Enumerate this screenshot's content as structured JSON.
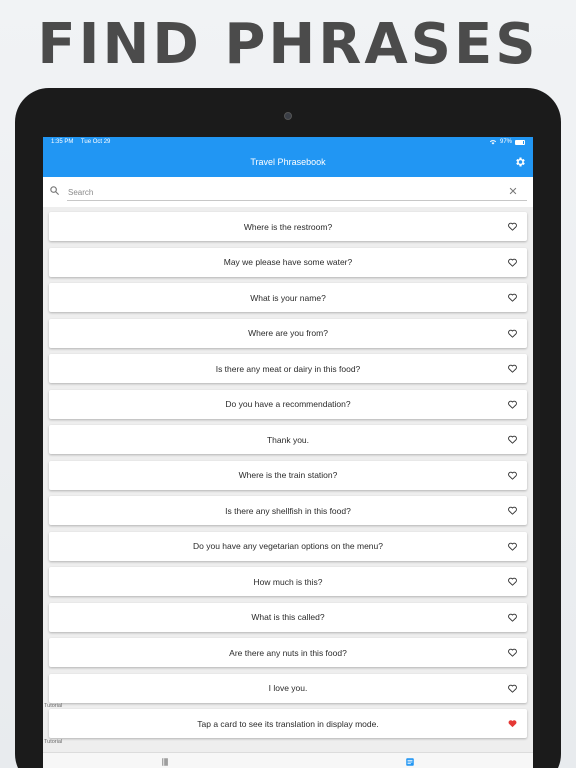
{
  "headline": "FIND PHRASES",
  "status": {
    "time": "1:35 PM",
    "date": "Tue Oct 29",
    "battery": "97%"
  },
  "app": {
    "title": "Travel Phrasebook"
  },
  "search": {
    "placeholder": "Search",
    "value": ""
  },
  "phrases": [
    "Where is the restroom?",
    "May we please have some water?",
    "What is your name?",
    "Where are you from?",
    "Is there any meat or dairy in this food?",
    "Do you have a recommendation?",
    "Thank you.",
    "Where is the train station?",
    "Is there any shellfish in this food?",
    "Do you have any vegetarian options on the menu?",
    "How much is this?",
    "What is this called?",
    "Are there any nuts in this food?",
    "I love you."
  ],
  "tutorial": {
    "label": "Tutorial",
    "card_text": "Tap a card to see its translation in display mode.",
    "favorited": true,
    "label2": "Tutorial"
  },
  "colors": {
    "accent": "#2196f3",
    "heart_active": "#e53935"
  }
}
